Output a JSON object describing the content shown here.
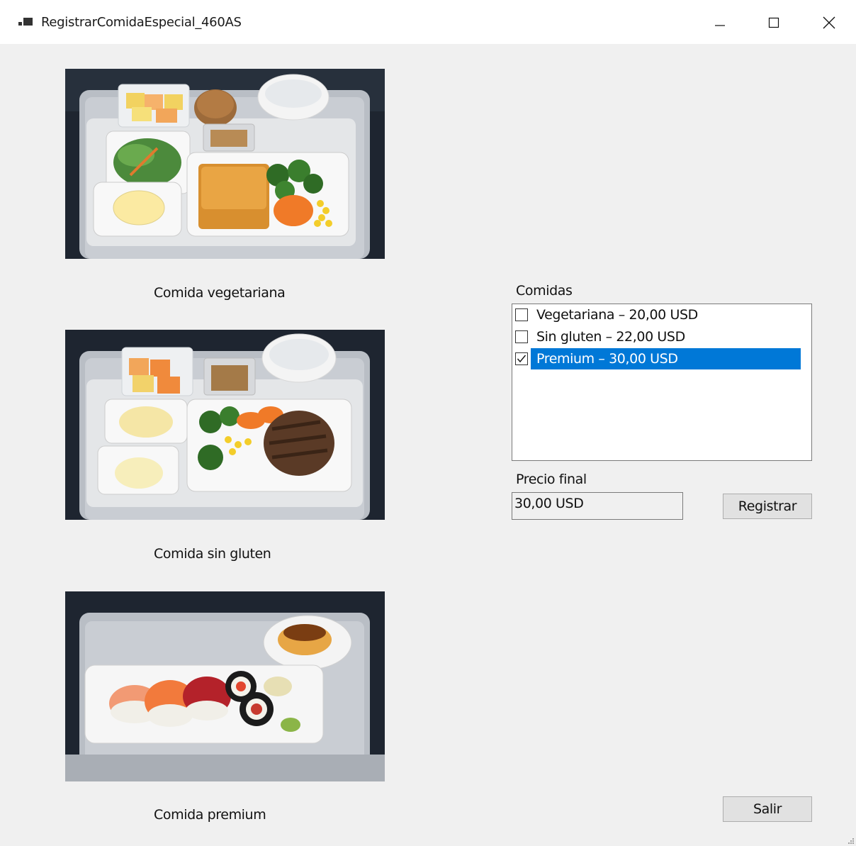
{
  "window": {
    "title": "RegistrarComidaEspecial_460AS",
    "controls": [
      "minimize",
      "maximize",
      "close"
    ]
  },
  "meals": [
    {
      "caption": "Comida vegetariana",
      "image": "vegetarian-meal-tray"
    },
    {
      "caption": "Comida sin gluten",
      "image": "gluten-free-meal-tray"
    },
    {
      "caption": "Comida premium",
      "image": "premium-sushi-tray"
    }
  ],
  "list": {
    "label": "Comidas",
    "items": [
      {
        "label": "Vegetariana – 20,00 USD",
        "checked": false,
        "selected": false
      },
      {
        "label": "Sin gluten – 22,00 USD",
        "checked": false,
        "selected": false
      },
      {
        "label": "Premium – 30,00 USD",
        "checked": true,
        "selected": true
      }
    ]
  },
  "price": {
    "label": "Precio final",
    "value": "30,00 USD"
  },
  "buttons": {
    "register": "Registrar",
    "exit": "Salir"
  },
  "colors": {
    "selection": "#0078d7",
    "background": "#f0f0f0"
  }
}
